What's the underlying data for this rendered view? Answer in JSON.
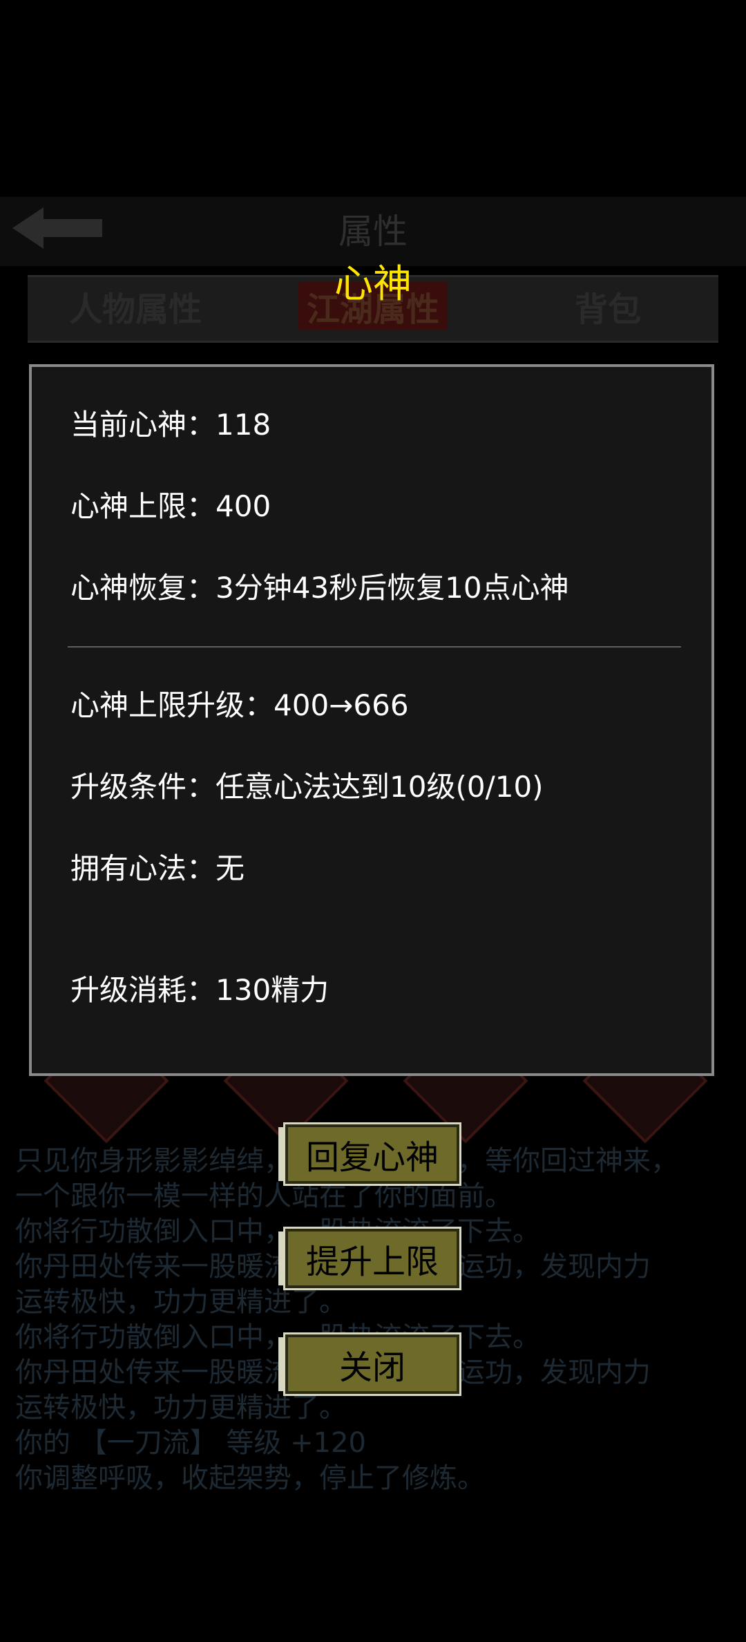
{
  "background": {
    "header_title": "属性",
    "tabs": [
      {
        "label": "人物属性"
      },
      {
        "label": "江湖属性"
      },
      {
        "label": "背包"
      }
    ],
    "log_lines": [
      "只见你身形影影绰绰，让人捉摸不定，等你回过神来，",
      "一个跟你一模一样的人站在了你的面前。",
      "你将行功散倒入口中，一股热流流了下去。",
      "你丹田处传来一股暖流，你赶紧打坐运功，发现内力",
      "运转极快，功力更精进了。",
      "你将行功散倒入口中，一股热流流了下去。",
      "你丹田处传来一股暖流，你赶紧打坐运功，发现内力",
      "运转极快，功力更精进了。",
      "你的 【一刀流】 等级 +120",
      "你调整呼吸，收起架势，停止了修炼。"
    ]
  },
  "dialog": {
    "title": "心神",
    "rows": [
      {
        "label": "当前心神：",
        "value": "118"
      },
      {
        "label": "心神上限：",
        "value": "400"
      },
      {
        "label": "心神恢复：",
        "value": "3分钟43秒后恢复10点心神"
      },
      {
        "label": "心神上限升级：",
        "value": "400→666"
      },
      {
        "label": "升级条件：",
        "value": "任意心法达到10级(0/10)"
      },
      {
        "label": "拥有心法：",
        "value": "无"
      },
      {
        "label": "升级消耗：",
        "value": "130精力"
      }
    ]
  },
  "buttons": {
    "restore": "回复心神",
    "upgrade": "提升上限",
    "close": "关闭"
  },
  "colors": {
    "title": "#ffe600",
    "button_fill": "#6e6a2a",
    "dialog_border": "#8a8a8a"
  }
}
